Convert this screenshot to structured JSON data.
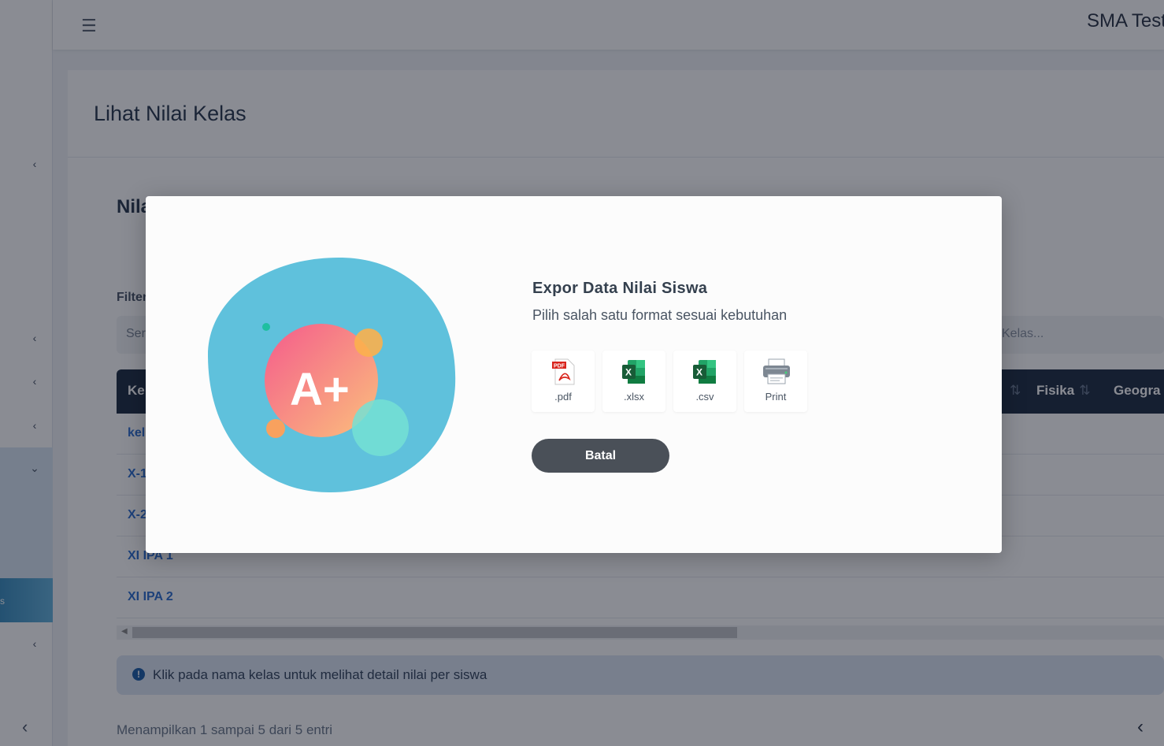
{
  "app": {
    "title": "SMA Test"
  },
  "page": {
    "title": "Lihat Nilai Kelas",
    "section_title": "Nila"
  },
  "filter": {
    "label": "Filter",
    "search_placeholder": "Ser",
    "class_placeholder": "Kelas..."
  },
  "table": {
    "headers": {
      "first": "Ke",
      "fisika": "Fisika",
      "geografi": "Geogra"
    },
    "rows": [
      "kel",
      "X-1",
      "X-2",
      "XI IPA 1",
      "XI IPA 2"
    ]
  },
  "info": {
    "text": "Klik pada nama kelas untuk melihat detail nilai per siswa"
  },
  "footer": {
    "showing": "Menampilkan 1 sampai 5 dari 5 entri"
  },
  "sidebar": {
    "active_label": "s"
  },
  "modal": {
    "title": "Expor Data Nilai Siswa",
    "subtitle": "Pilih salah satu format sesuai kebutuhan",
    "formats": [
      {
        "label": ".pdf",
        "icon": "pdf-icon"
      },
      {
        "label": ".xlsx",
        "icon": "excel-icon"
      },
      {
        "label": ".csv",
        "icon": "excel-icon"
      },
      {
        "label": "Print",
        "icon": "printer-icon"
      }
    ],
    "cancel_label": "Batal",
    "illustration_text": "A+"
  },
  "colors": {
    "accent": "#2f6fd0",
    "table_header": "#1f2e44",
    "blob": "#5fc1dc",
    "button": "#4a5058"
  }
}
